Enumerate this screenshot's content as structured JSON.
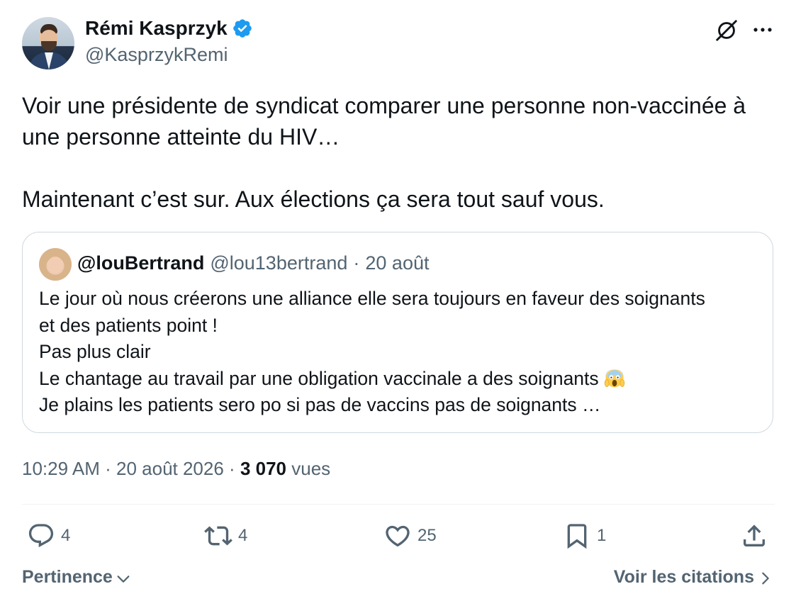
{
  "author": {
    "name": "Rémi Kasprzyk",
    "handle": "@KasprzykRemi",
    "verified_color": "#1d9bf0"
  },
  "tweet": {
    "paragraphs": [
      "Voir une présidente de syndicat comparer une personne non-vaccinée à une personne atteinte du HIV…",
      "Maintenant c’est sur. Aux élections ça sera tout sauf vous."
    ]
  },
  "quoted_tweet": {
    "name": "@louBertrand",
    "handle": "@lou13bertrand",
    "separator": "·",
    "date": "20 août",
    "lines": [
      "Le jour où nous créerons une alliance elle sera toujours en faveur des soignants",
      "et des patients point !",
      "Pas plus clair",
      "Le chantage au travail par une obligation vaccinale a des soignants",
      "Je plains les patients sero po si pas de vaccins pas de soignants …"
    ],
    "emoji": "screaming-face-emoji"
  },
  "meta": {
    "time": "10:29 AM",
    "date": "20 août 2026",
    "separator": "·",
    "views_count": "3 070",
    "views_label": "vues"
  },
  "actions": {
    "replies": "4",
    "reposts": "4",
    "likes": "25",
    "bookmarks": "1"
  },
  "footer": {
    "sort_label": "Pertinence",
    "quotes_label": "Voir les citations"
  },
  "icons": [
    "verified-badge-icon",
    "grok-icon",
    "more-icon",
    "reply-icon",
    "repost-icon",
    "like-icon",
    "bookmark-icon",
    "share-icon",
    "chevron-down-icon",
    "chevron-right-icon"
  ]
}
